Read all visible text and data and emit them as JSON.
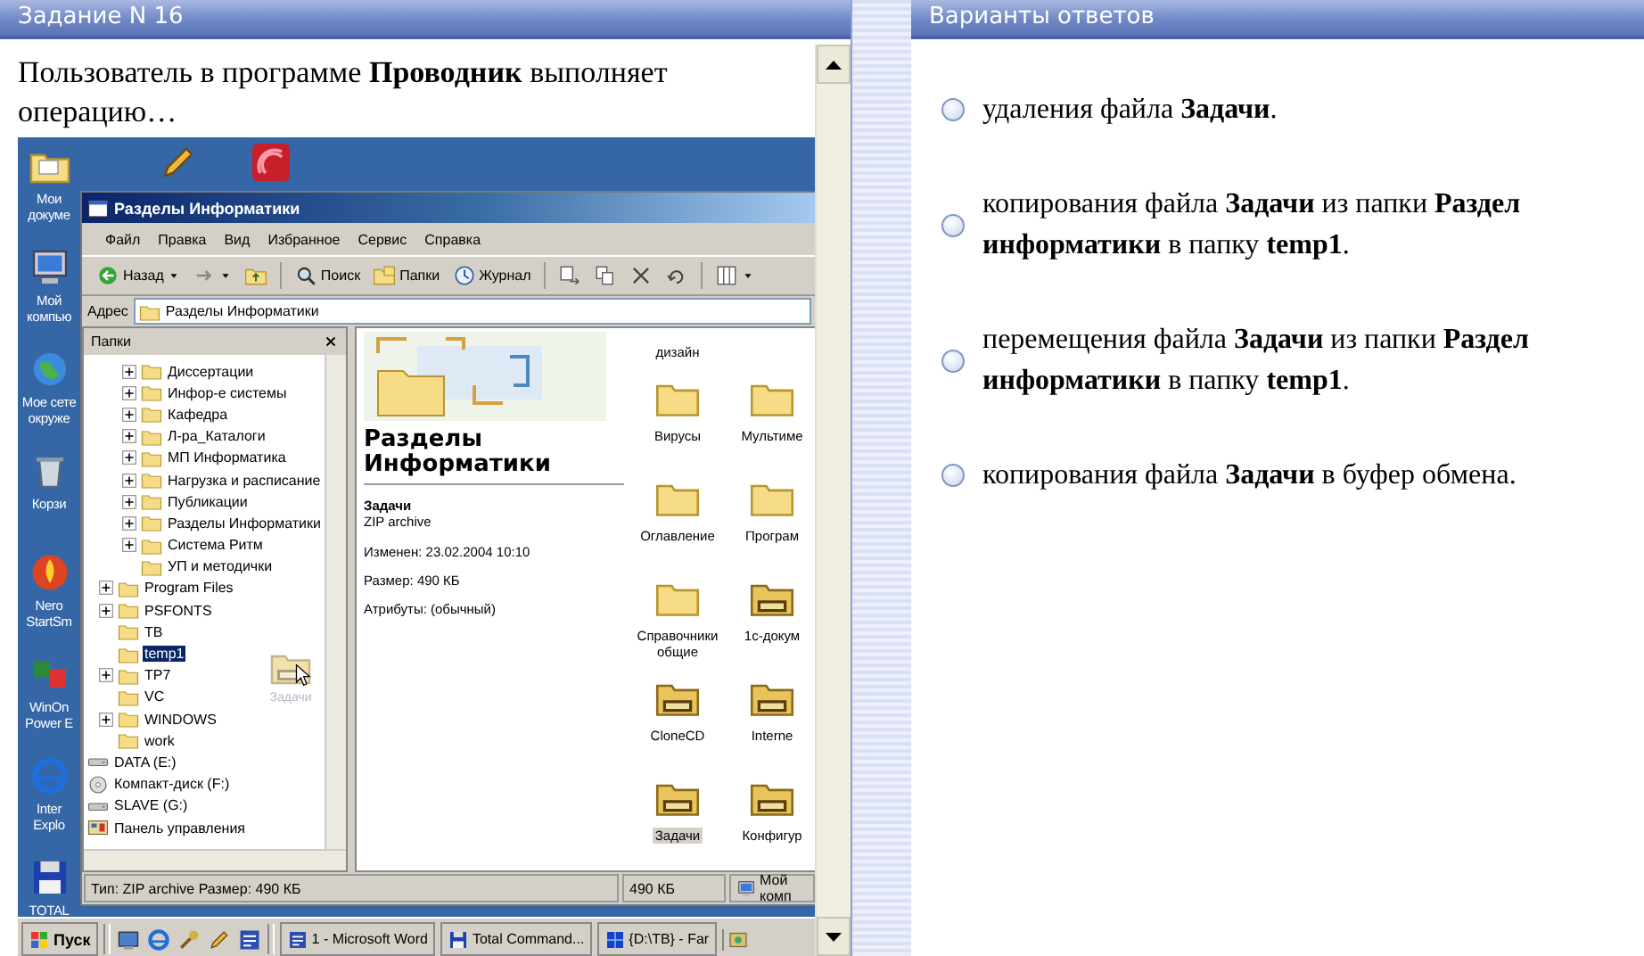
{
  "question": {
    "title": "Задание N 16",
    "text": "Пользователь в программе **Проводник** выполняет операцию…"
  },
  "screenshot": {
    "top_icons": [
      {
        "kind": "pen"
      },
      {
        "kind": "sound"
      }
    ],
    "desktop_icons": [
      {
        "label": "Мои\nдокуме",
        "kind": "documents"
      },
      {
        "label": "Мой\nкомпью",
        "kind": "computer"
      },
      {
        "label": "Мое сете\nокруже",
        "kind": "network"
      },
      {
        "label": "Корзи",
        "kind": "recycle"
      },
      {
        "label": "Nero\nStartSm",
        "kind": "nero"
      },
      {
        "label": "WinOn\nPower E",
        "kind": "app"
      },
      {
        "label": "Inter\nExplo",
        "kind": "ie"
      },
      {
        "label": "TOTAL",
        "kind": "total"
      }
    ],
    "window": {
      "title": "Разделы Информатики",
      "menu": [
        "Файл",
        "Правка",
        "Вид",
        "Избранное",
        "Сервис",
        "Справка"
      ],
      "toolbar": [
        {
          "kind": "back",
          "label": "Назад"
        },
        {
          "kind": "forward"
        },
        {
          "kind": "up"
        },
        {
          "kind": "search",
          "label": "Поиск"
        },
        {
          "kind": "folders",
          "label": "Папки"
        },
        {
          "kind": "history",
          "label": "Журнал"
        },
        {
          "kind": "move"
        },
        {
          "kind": "copy"
        },
        {
          "kind": "delete"
        },
        {
          "kind": "undo"
        },
        {
          "kind": "views"
        }
      ],
      "address": {
        "label": "Адрес",
        "value": "Разделы Информатики"
      },
      "folders_pane": {
        "title": "Папки",
        "drag_label": "Задачи",
        "tree": [
          {
            "children": [
              {
                "children": [
                  {
                    "label": "Диссертации",
                    "kind": "folder",
                    "expandable": true,
                    "selected": false
                  },
                  {
                    "label": "Инфор-е системы",
                    "kind": "folder",
                    "expandable": true,
                    "selected": false
                  },
                  {
                    "label": "Кафедра",
                    "kind": "folder",
                    "expandable": true,
                    "selected": false
                  },
                  {
                    "label": "Л-ра_Каталоги",
                    "kind": "folder",
                    "expandable": true,
                    "selected": false
                  },
                  {
                    "label": "МП Информатика",
                    "kind": "folder",
                    "expandable": true,
                    "selected": false
                  },
                  {
                    "label": "Нагрузка и расписание",
                    "kind": "folder",
                    "expandable": true,
                    "selected": false
                  },
                  {
                    "label": "Публикации",
                    "kind": "folder",
                    "expandable": true,
                    "selected": false
                  },
                  {
                    "label": "Разделы Информатики",
                    "kind": "folder",
                    "expandable": true,
                    "selected": false
                  },
                  {
                    "label": "Система Ритм",
                    "kind": "folder",
                    "expandable": true,
                    "selected": false
                  },
                  {
                    "label": "УП и методички",
                    "kind": "folder",
                    "expandable": false,
                    "selected": false
                  }
                ]
              },
              {
                "label": "Program Files",
                "kind": "folder",
                "expandable": true,
                "selected": false
              },
              {
                "label": "PSFONTS",
                "kind": "folder",
                "expandable": true,
                "selected": false
              },
              {
                "label": "TB",
                "kind": "folder",
                "expandable": false,
                "selected": false
              },
              {
                "label": "temp1",
                "kind": "folder",
                "expandable": false,
                "selected": true
              },
              {
                "label": "TP7",
                "kind": "folder",
                "expandable": true,
                "selected": false
              },
              {
                "label": "VC",
                "kind": "folder",
                "expandable": false,
                "selected": false
              },
              {
                "label": "WINDOWS",
                "kind": "folder",
                "expandable": true,
                "selected": false
              },
              {
                "label": "work",
                "kind": "folder",
                "expandable": false,
                "selected": false
              }
            ]
          },
          {
            "label": "DATA (E:)",
            "kind": "drive",
            "expandable": false,
            "selected": false
          },
          {
            "label": "Компакт-диск (F:)",
            "kind": "cdrom",
            "expandable": false,
            "selected": false
          },
          {
            "label": "SLAVE (G:)",
            "kind": "drive",
            "expandable": false,
            "selected": false
          },
          {
            "label": "Панель управления",
            "kind": "control",
            "expandable": false,
            "selected": false
          }
        ]
      },
      "details": {
        "title": "Разделы Информатики",
        "name": "Задачи",
        "type": "ZIP archive",
        "lines": [
          "Изменен: 23.02.2004 10:10",
          "Размер: 490 КБ",
          "Атрибуты: (обычный)"
        ]
      },
      "files": [
        {
          "label": "дизайн",
          "kind": "cut",
          "selected": false
        },
        {
          "label": "Вирусы",
          "kind": "folder",
          "selected": false
        },
        {
          "label": "Мультиме",
          "kind": "folder",
          "selected": false
        },
        {
          "label": "Оглавление",
          "kind": "folder",
          "selected": false
        },
        {
          "label": "Програм",
          "kind": "folder",
          "selected": false
        },
        {
          "label": "Справочники общие",
          "kind": "folder",
          "selected": false
        },
        {
          "label": "1с-докум",
          "kind": "zip",
          "selected": false
        },
        {
          "label": "CloneCD",
          "kind": "zip",
          "selected": false
        },
        {
          "label": "Interne",
          "kind": "zip",
          "selected": false
        },
        {
          "label": "Задачи",
          "kind": "zip",
          "selected": true
        },
        {
          "label": "Конфигур",
          "kind": "zip",
          "selected": false
        }
      ],
      "status": [
        {
          "text": "Тип: ZIP archive Размер: 490 КБ",
          "kind": "text"
        },
        {
          "text": "490 КБ",
          "kind": "text"
        },
        {
          "text": "Мой комп",
          "kind": "zone"
        }
      ]
    },
    "taskbar": {
      "start": "Пуск",
      "quick_launch": [
        {
          "kind": "desktop"
        },
        {
          "kind": "ie"
        },
        {
          "kind": "tools"
        },
        {
          "kind": "pen"
        },
        {
          "kind": "word"
        }
      ],
      "tasks": [
        {
          "label": "1 - Microsoft Word",
          "kind": "word"
        },
        {
          "label": "Total Command...",
          "kind": "total"
        },
        {
          "label": "{D:\\TB} - Far",
          "kind": "far"
        }
      ],
      "tray": [
        {
          "kind": "tray"
        }
      ]
    }
  },
  "answers": {
    "title": "Варианты ответов",
    "options": [
      {
        "lines": [
          "удаления файла **Задачи**."
        ],
        "selected": false
      },
      {
        "lines": [
          "копирования файла **Задачи** из папки **Раздел**",
          "**информатики** в папку **temp1**."
        ],
        "selected": false
      },
      {
        "lines": [
          "перемещения файла **Задачи** из папки **Раздел**",
          "**информатики** в папку **temp1**."
        ],
        "selected": false
      },
      {
        "lines": [
          "копирования файла **Задачи** в буфер обмена."
        ],
        "selected": false
      }
    ]
  }
}
